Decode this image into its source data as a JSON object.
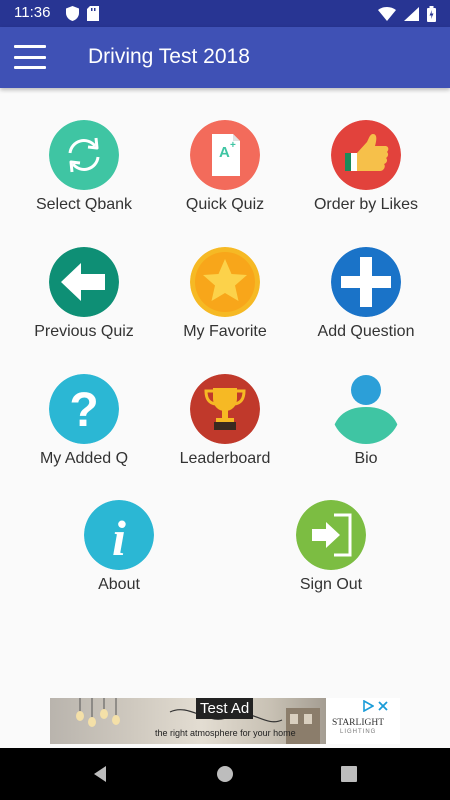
{
  "status_bar": {
    "time": "11:36"
  },
  "app_bar": {
    "title": "Driving Test 2018"
  },
  "menu": [
    {
      "label": "Select Qbank",
      "icon": "refresh-icon",
      "color": "#3fc5a3"
    },
    {
      "label": "Quick Quiz",
      "icon": "grade-paper-icon",
      "color": "#f36b5b"
    },
    {
      "label": "Order by Likes",
      "icon": "thumbs-up-icon",
      "color": "#e2423c"
    },
    {
      "label": "Previous Quiz",
      "icon": "arrow-left-icon",
      "color": "#0e8f75"
    },
    {
      "label": "My Favorite",
      "icon": "star-icon",
      "color": "#f6b924"
    },
    {
      "label": "Add Question",
      "icon": "plus-icon",
      "color": "#1a73c8"
    },
    {
      "label": "My Added Q",
      "icon": "question-mark-icon",
      "color": "#2bb7d4"
    },
    {
      "label": "Leaderboard",
      "icon": "trophy-icon",
      "color": "#c0392b"
    },
    {
      "label": "Bio",
      "icon": "person-icon",
      "color": "#2c9fd8"
    },
    {
      "label": "About",
      "icon": "info-icon",
      "color": "#2bb7d4"
    },
    {
      "label": "Sign Out",
      "icon": "sign-out-icon",
      "color": "#7cbd42"
    }
  ],
  "ad": {
    "label": "Test Ad",
    "tagline_1": "the right",
    "tagline_2": "atmosphere",
    "tagline_3": "for your home",
    "brand": "STARLIGHT",
    "brand_sub": "LIGHTING"
  }
}
